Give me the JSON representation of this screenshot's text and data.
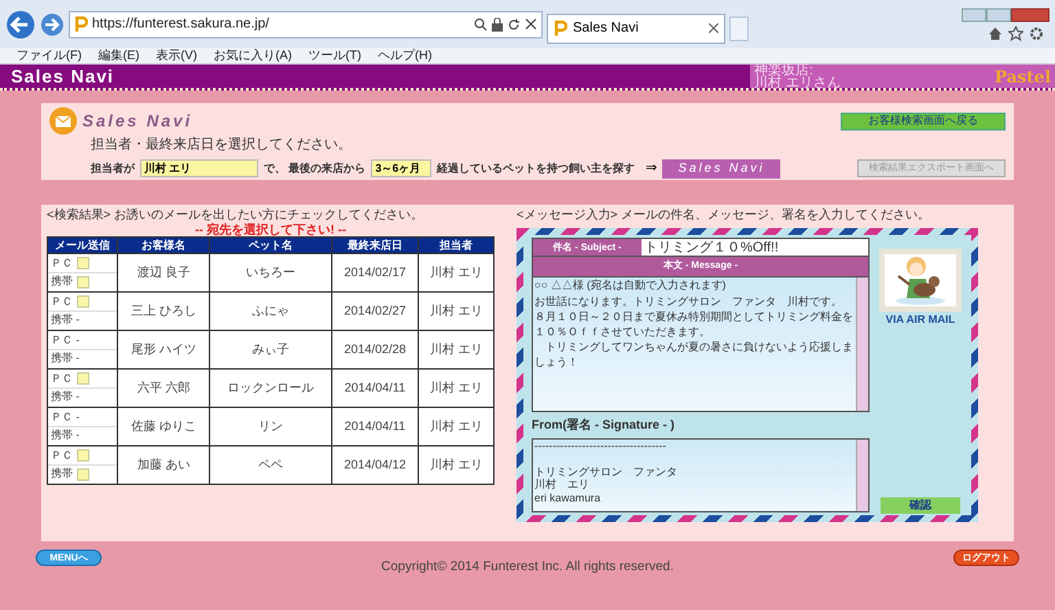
{
  "browser": {
    "url": "https://funterest.sakura.ne.jp/",
    "tab": "Sales Navi",
    "menu": [
      "ファイル(F)",
      "編集(E)",
      "表示(V)",
      "お気に入り(A)",
      "ツール(T)",
      "ヘルプ(H)"
    ]
  },
  "header": {
    "title": "Sales Navi",
    "shop": "神楽坂店:",
    "user": "川村 エリさん",
    "logo": "Pastel"
  },
  "search": {
    "title": "Sales Navi",
    "instruction": "担当者・最終来店日を選択してください。",
    "staff_label": "担当者が",
    "staff_value": "川村 エリ",
    "mid_label": "で、 最後の来店から",
    "period_value": "3～6ヶ月",
    "end_label": "経過しているペットを持つ飼い主を探す",
    "arrow": "⇒",
    "search_button": "Sales Navi",
    "back_button": "お客様検索画面へ戻る",
    "export_button": "検索結果エクスポート画面へ",
    "export_disabled": true
  },
  "results": {
    "caption": "<検索結果> お誘いのメールを出したい方にチェックしてください。",
    "warning": "-- 宛先を選択して下さい! --",
    "columns": [
      "メール送信",
      "お客様名",
      "ペット名",
      "最終来店日",
      "担当者"
    ],
    "rows": [
      {
        "mail": [
          {
            "label": "ＰＣ",
            "kind": "checkbox",
            "checked": false
          },
          {
            "label": "携帯",
            "kind": "checkbox",
            "checked": false
          }
        ],
        "name": "渡辺 良子",
        "pet": "いちろー",
        "date": "2014/02/17",
        "staff": "川村 エリ"
      },
      {
        "mail": [
          {
            "label": "ＰＣ",
            "kind": "checkbox",
            "checked": false
          },
          {
            "label": "携帯 -",
            "kind": "text"
          }
        ],
        "name": "三上 ひろし",
        "pet": "ふにゃ",
        "date": "2014/02/27",
        "staff": "川村 エリ"
      },
      {
        "mail": [
          {
            "label": "ＰＣ -",
            "kind": "text"
          },
          {
            "label": "携帯 -",
            "kind": "text"
          }
        ],
        "name": "尾形 ハイツ",
        "pet": "みぃ子",
        "date": "2014/02/28",
        "staff": "川村 エリ"
      },
      {
        "mail": [
          {
            "label": "ＰＣ",
            "kind": "checkbox",
            "checked": false
          },
          {
            "label": "携帯 -",
            "kind": "text"
          }
        ],
        "name": "六平 六郎",
        "pet": "ロックンロール",
        "date": "2014/04/11",
        "staff": "川村 エリ"
      },
      {
        "mail": [
          {
            "label": "ＰＣ -",
            "kind": "text"
          },
          {
            "label": "携帯 -",
            "kind": "text"
          }
        ],
        "name": "佐藤 ゆりこ",
        "pet": "リン",
        "date": "2014/04/11",
        "staff": "川村 エリ"
      },
      {
        "mail": [
          {
            "label": "ＰＣ",
            "kind": "checkbox",
            "checked": false
          },
          {
            "label": "携帯",
            "kind": "checkbox",
            "checked": false
          }
        ],
        "name": "加藤 あい",
        "pet": "ペペ",
        "date": "2014/04/12",
        "staff": "川村 エリ"
      }
    ]
  },
  "message": {
    "caption": "<メッセージ入力> メールの件名、メッセージ、署名を入力してください。",
    "subject_label": "件名 - Subject -",
    "subject": "トリミング１０%Off!!",
    "body_label": "本文 - Message -",
    "salutation": "○○ △△様 (宛名は自動で入力されます)",
    "body_lines": [
      "お世話になります。トリミングサロン　ファンタ　川村です。",
      "８月１０日～２０日まで夏休み特別期間としてトリミング料金を１０％Ｏｆｆさせていただきます。",
      "　トリミングしてワンちゃんが夏の暑さに負けないよう応援しましょう！"
    ],
    "signature_label": "From(署名 - Signature - )",
    "signature_lines": [
      "------------------------------------",
      "トリミングサロン　ファンタ",
      "川村　エリ",
      "eri kawamura"
    ],
    "stamp_caption": "VIA AIR MAIL",
    "confirm_button": "確認"
  },
  "footer": {
    "menu_button": "MENUへ",
    "copyright": "Copyright© 2014 Funterest Inc. All rights reserved.",
    "logout_button": "ログアウト"
  }
}
